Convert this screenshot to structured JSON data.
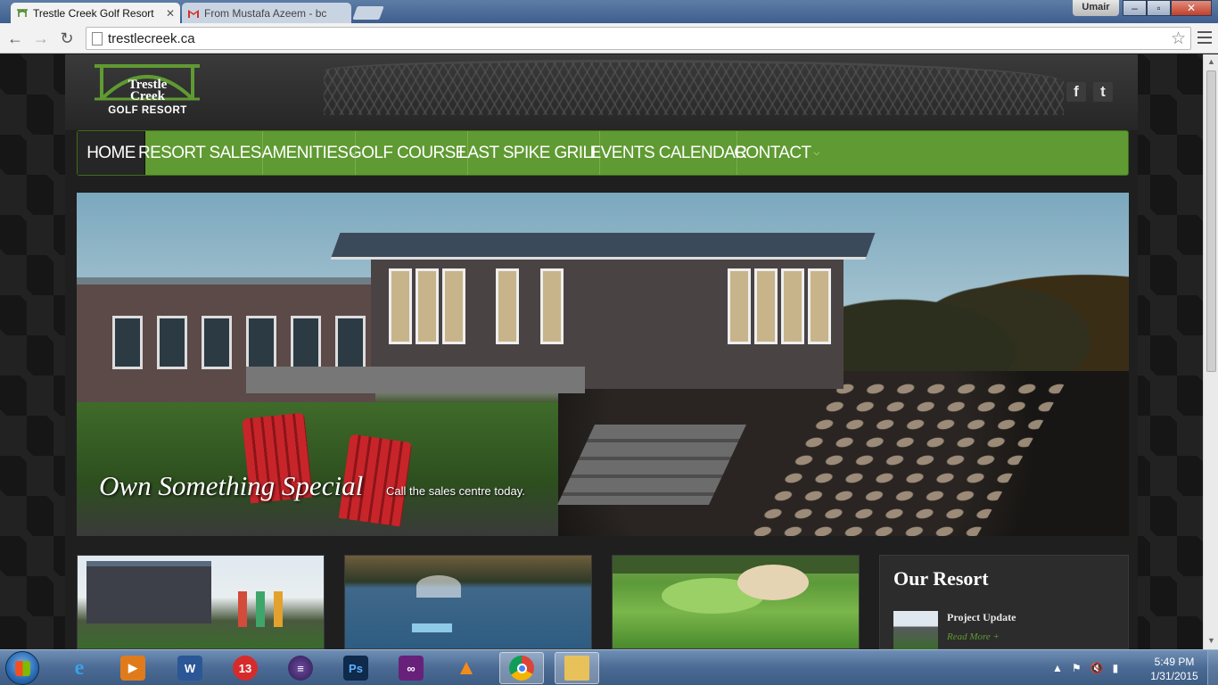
{
  "browser": {
    "tabs": [
      {
        "title": "Trestle Creek Golf Resort",
        "active": true
      },
      {
        "title": "From Mustafa Azeem - bc",
        "active": false
      }
    ],
    "user": "Umair",
    "url": "trestlecreek.ca"
  },
  "site": {
    "logo": {
      "line1": "Trestle",
      "line2": "Creek",
      "line3": "GOLF RESORT"
    },
    "social": [
      {
        "name": "facebook",
        "glyph": "f"
      },
      {
        "name": "twitter",
        "glyph": "t"
      }
    ],
    "nav": [
      {
        "label": "HOME",
        "dropdown": false,
        "active": true
      },
      {
        "label": "RESORT SALES",
        "dropdown": true
      },
      {
        "label": "AMENITIES",
        "dropdown": true
      },
      {
        "label": "GOLF COURSE",
        "dropdown": true
      },
      {
        "label": "LAST SPIKE GRILL",
        "dropdown": true
      },
      {
        "label": "EVENTS CALENDAR",
        "dropdown": false
      },
      {
        "label": "CONTACT",
        "dropdown": true
      }
    ],
    "hero": {
      "slogan": "Own Something Special",
      "cta": "Call the sales centre today."
    },
    "sidebar": {
      "heading": "Our Resort",
      "post_title": "Project Update",
      "read_more": "Read More +"
    },
    "colors": {
      "nav_green": "#5f9a32",
      "link_green": "#5f9a32",
      "background": "#1b1b1b"
    }
  },
  "taskbar": {
    "apps": [
      "internet-explorer",
      "windows-media-player",
      "microsoft-word",
      "app-13",
      "eclipse",
      "photoshop",
      "visual-studio",
      "vlc",
      "chrome",
      "file-explorer"
    ],
    "time": "5:49 PM",
    "date": "1/31/2015"
  }
}
